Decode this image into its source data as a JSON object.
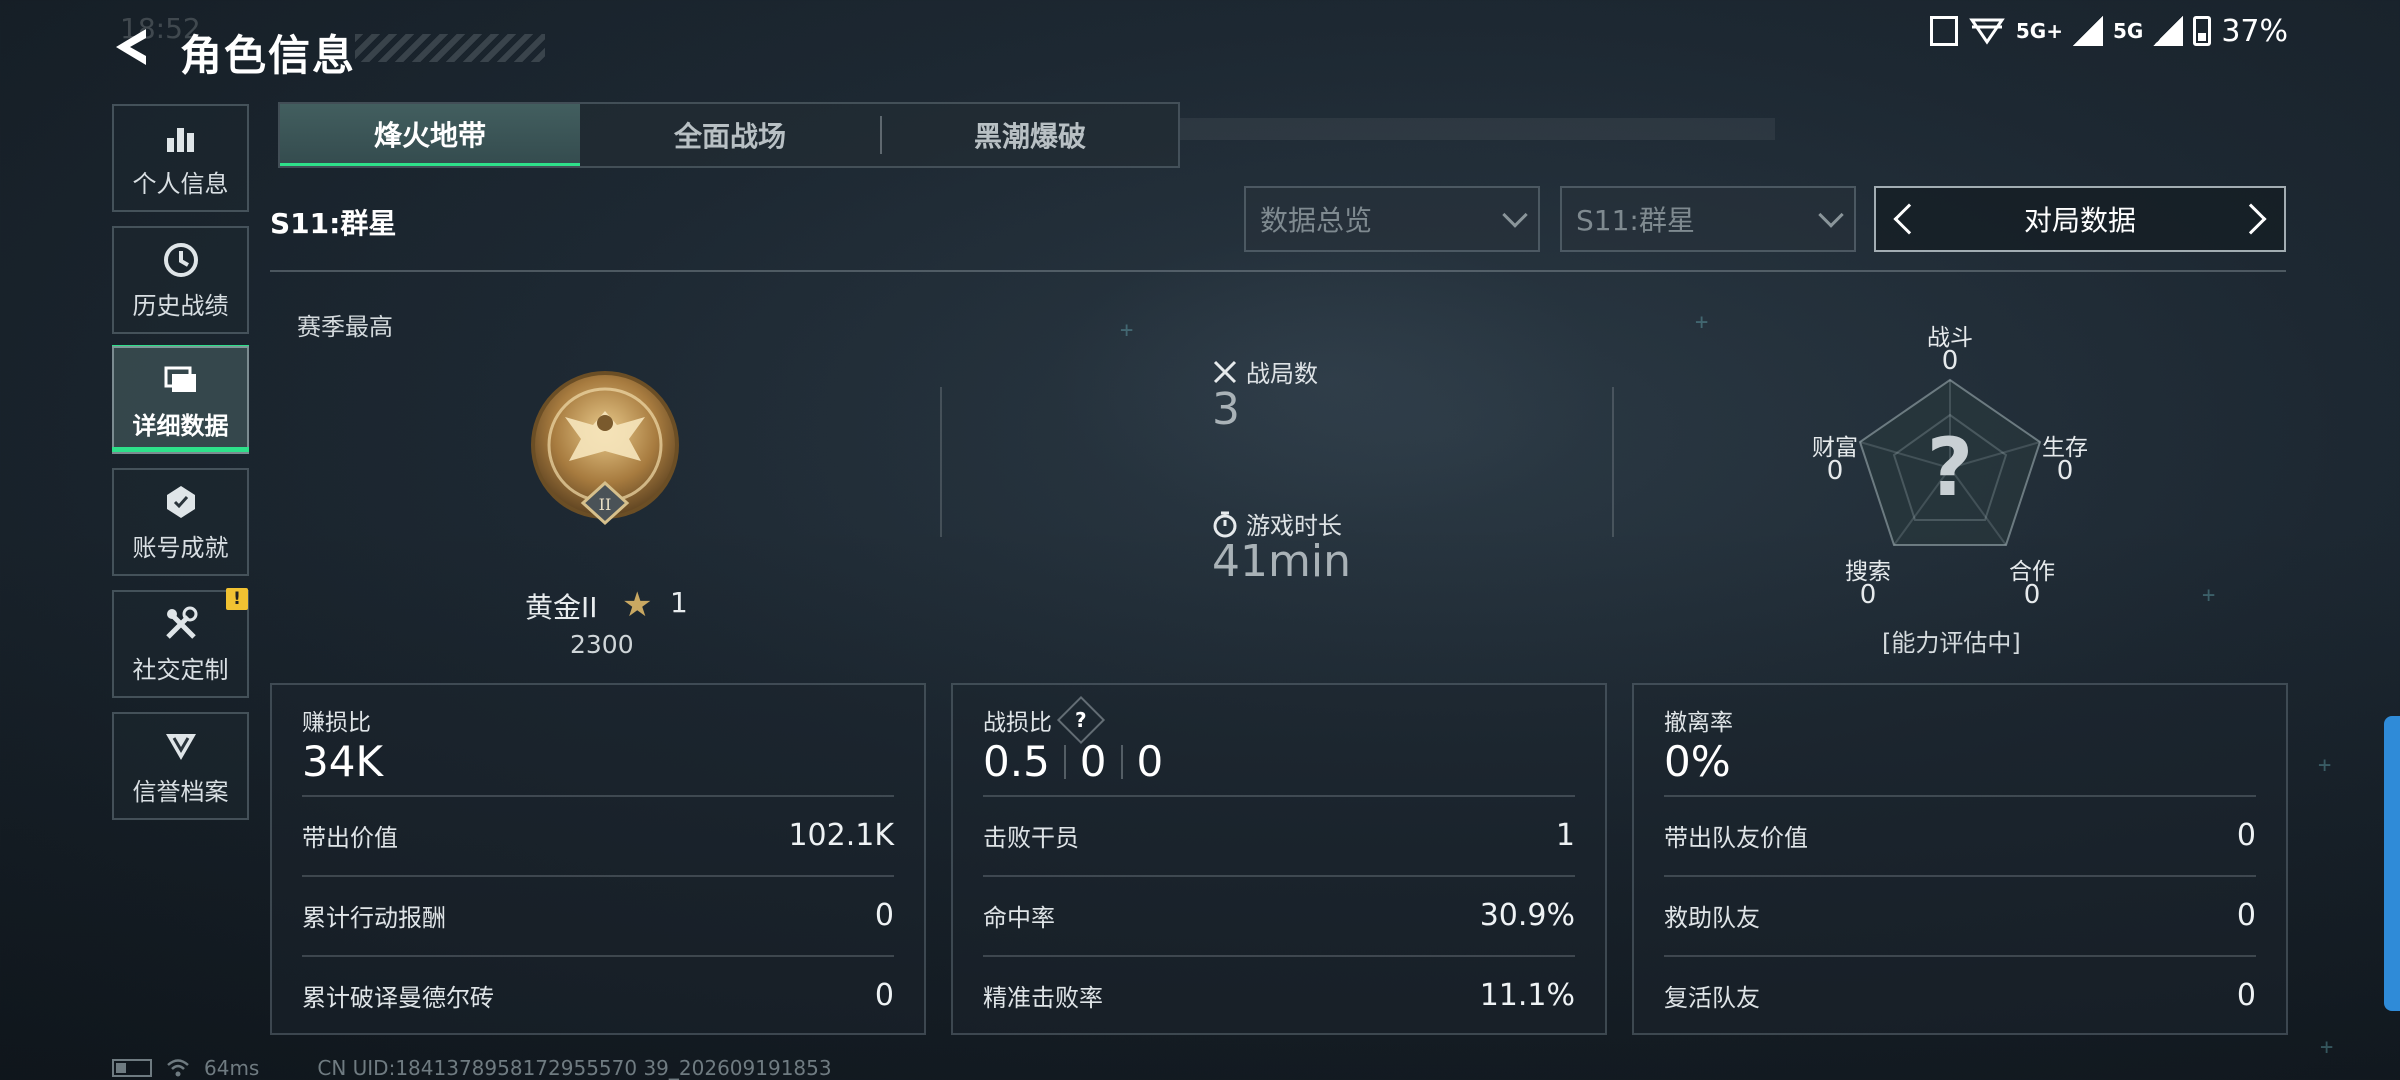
{
  "status_bar": {
    "network1": "5G+",
    "network2": "5G",
    "battery": "37%"
  },
  "header": {
    "ghost_time": "18:52",
    "title": "角色信息"
  },
  "sidebar": {
    "items": [
      {
        "label": "个人信息",
        "icon": "bar-chart-icon"
      },
      {
        "label": "历史战绩",
        "icon": "history-icon"
      },
      {
        "label": "详细数据",
        "icon": "folders-icon",
        "active": true
      },
      {
        "label": "账号成就",
        "icon": "achievement-icon"
      },
      {
        "label": "社交定制",
        "icon": "tools-icon",
        "badge": "!"
      },
      {
        "label": "信誉档案",
        "icon": "reputation-icon"
      }
    ]
  },
  "tabs": [
    {
      "label": "烽火地带",
      "active": true
    },
    {
      "label": "全面战场"
    },
    {
      "label": "黑潮爆破"
    }
  ],
  "season": "S11:群星",
  "filters": {
    "overview": "数据总览",
    "season": "S11:群星",
    "mode": "对局数据"
  },
  "rank": {
    "section_label": "赛季最高",
    "name": "黄金II",
    "medal_tier": "II",
    "stars": "1",
    "score": "2300"
  },
  "match": {
    "games_label": "战局数",
    "games": "3",
    "duration_label": "游戏时长",
    "duration": "41min"
  },
  "radar": {
    "combat_label": "战斗",
    "combat": "0",
    "survival_label": "生存",
    "survival": "0",
    "coop_label": "合作",
    "coop": "0",
    "search_label": "搜索",
    "search": "0",
    "wealth_label": "财富",
    "wealth": "0",
    "note": "[能力评估中]"
  },
  "panels": {
    "profit": {
      "title": "赚损比",
      "value": "34K",
      "rows": [
        {
          "k": "带出价值",
          "v": "102.1K"
        },
        {
          "k": "累计行动报酬",
          "v": "0"
        },
        {
          "k": "累计破译曼德尔砖",
          "v": "0"
        }
      ]
    },
    "kd": {
      "title": "战损比",
      "help": "?",
      "values": [
        "0.5",
        "0",
        "0"
      ],
      "rows": [
        {
          "k": "击败干员",
          "v": "1"
        },
        {
          "k": "命中率",
          "v": "30.9%"
        },
        {
          "k": "精准击败率",
          "v": "11.1%"
        }
      ]
    },
    "extract": {
      "title": "撤离率",
      "value": "0%",
      "rows": [
        {
          "k": "带出队友价值",
          "v": "0"
        },
        {
          "k": "救助队友",
          "v": "0"
        },
        {
          "k": "复活队友",
          "v": "0"
        }
      ]
    }
  },
  "footer": {
    "ping": "64ms",
    "uid": "CN UID:1841378958172955570 39_202609191853"
  },
  "colors": {
    "accent": "#2ee08a",
    "badge": "#f1c232",
    "side_handle": "#2f8bd8"
  }
}
